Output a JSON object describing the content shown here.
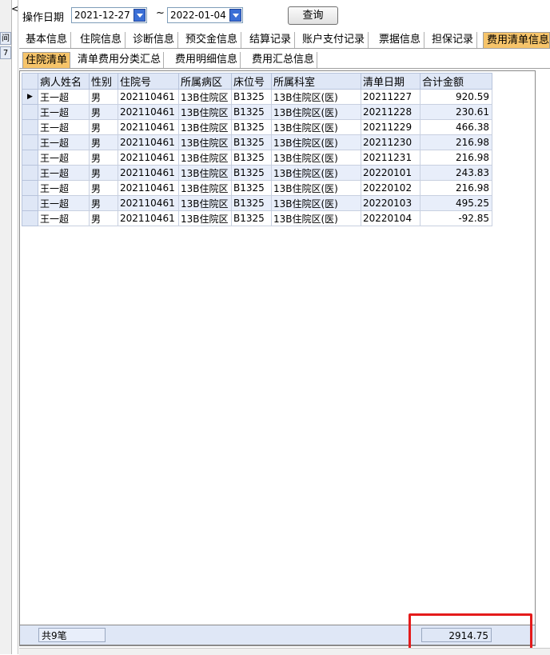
{
  "left_panel": {
    "cells": [
      "间",
      "7"
    ],
    "arrow": "<"
  },
  "toolbar": {
    "date_label": "操作日期",
    "start_date": "2021-12-27",
    "separator": "~",
    "end_date": "2022-01-04",
    "query_label": "查询"
  },
  "main_tabs": [
    {
      "label": "基本信息"
    },
    {
      "label": "住院信息"
    },
    {
      "label": "诊断信息"
    },
    {
      "label": "预交金信息"
    },
    {
      "label": "结算记录"
    },
    {
      "label": "账户支付记录"
    },
    {
      "label": "票据信息"
    },
    {
      "label": "担保记录"
    },
    {
      "label": "费用清单信息"
    }
  ],
  "sub_tabs": [
    {
      "label": "住院清单"
    },
    {
      "label": "清单费用分类汇总"
    },
    {
      "label": "费用明细信息"
    },
    {
      "label": "费用汇总信息"
    }
  ],
  "grid": {
    "columns": [
      "病人姓名",
      "性别",
      "住院号",
      "所属病区",
      "床位号",
      "所属科室",
      "清单日期",
      "合计金额"
    ],
    "current_row_marker": "▶",
    "rows": [
      [
        "王一超",
        "男",
        "202110461",
        "13B住院区",
        "B1325",
        "13B住院区(医)",
        "20211227",
        "920.59"
      ],
      [
        "王一超",
        "男",
        "202110461",
        "13B住院区",
        "B1325",
        "13B住院区(医)",
        "20211228",
        "230.61"
      ],
      [
        "王一超",
        "男",
        "202110461",
        "13B住院区",
        "B1325",
        "13B住院区(医)",
        "20211229",
        "466.38"
      ],
      [
        "王一超",
        "男",
        "202110461",
        "13B住院区",
        "B1325",
        "13B住院区(医)",
        "20211230",
        "216.98"
      ],
      [
        "王一超",
        "男",
        "202110461",
        "13B住院区",
        "B1325",
        "13B住院区(医)",
        "20211231",
        "216.98"
      ],
      [
        "王一超",
        "男",
        "202110461",
        "13B住院区",
        "B1325",
        "13B住院区(医)",
        "20220101",
        "243.83"
      ],
      [
        "王一超",
        "男",
        "202110461",
        "13B住院区",
        "B1325",
        "13B住院区(医)",
        "20220102",
        "216.98"
      ],
      [
        "王一超",
        "男",
        "202110461",
        "13B住院区",
        "B1325",
        "13B住院区(医)",
        "20220103",
        "495.25"
      ],
      [
        "王一超",
        "男",
        "202110461",
        "13B住院区",
        "B1325",
        "13B住院区(医)",
        "20220104",
        "-92.85"
      ]
    ]
  },
  "footer": {
    "count_label": "共9笔",
    "total": "2914.75"
  },
  "colors": {
    "highlight_box": "#e41b1b",
    "active_tab": "#f6c46a",
    "grid_header": "#dfe7f6",
    "grid_alt_row": "#e8eefa"
  }
}
